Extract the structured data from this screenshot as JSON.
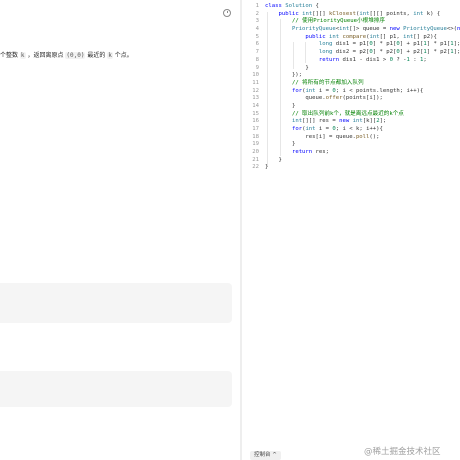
{
  "problem": {
    "desc_prefix": "个整数 ",
    "desc_k1": "k",
    "desc_mid": " ，返回离原点 ",
    "desc_origin": "(0,0)",
    "desc_mid2": " 最近的 ",
    "desc_k2": "k",
    "desc_suffix": " 个点。"
  },
  "editor": {
    "line_numbers": [
      "1",
      "2",
      "3",
      "4",
      "5",
      "6",
      "7",
      "8",
      "9",
      "10",
      "11",
      "12",
      "13",
      "14",
      "15",
      "16",
      "17",
      "18",
      "19",
      "20",
      "21",
      "22"
    ],
    "code": {
      "l1": [
        "class",
        " ",
        "Solution",
        " {"
      ],
      "l2": [
        "    ",
        "public",
        " ",
        "int",
        "[][] ",
        "kClosest",
        "(",
        "int",
        "[][] points, ",
        "int",
        " k) {"
      ],
      "l3": [
        "        ",
        "// 使用PriorityQueue小根堆排序"
      ],
      "l4": [
        "        ",
        "PriorityQueue",
        "<",
        "int",
        "[]> queue = ",
        "new",
        " ",
        "PriorityQueue",
        "<>(",
        "new",
        " Comp"
      ],
      "l5": [
        "            ",
        "public",
        " ",
        "int",
        " ",
        "compare",
        "(",
        "int",
        "[] p1, ",
        "int",
        "[] p2){"
      ],
      "l6": [
        "                ",
        "long",
        " dis1 = p1[",
        "0",
        "] * p1[",
        "0",
        "] + p1[",
        "1",
        "] * p1[",
        "1",
        "];"
      ],
      "l7": [
        "                ",
        "long",
        " dis2 = p2[",
        "0",
        "] * p2[",
        "0",
        "] + p2[",
        "1",
        "] * p2[",
        "1",
        "];"
      ],
      "l8": [
        "                ",
        "return",
        " dis1 - dis1 > ",
        "0",
        " ? -",
        "1",
        " : ",
        "1",
        ";"
      ],
      "l9": [
        "            }"
      ],
      "l10": [
        "        });"
      ],
      "l11": [
        "        ",
        "// 将所有的节点都加入队列"
      ],
      "l12": [
        "        ",
        "for",
        "(",
        "int",
        " i = ",
        "0",
        "; i < points.length; i++){"
      ],
      "l13": [
        "            queue.",
        "offer",
        "(points[i]);"
      ],
      "l14": [
        "        }"
      ],
      "l15": [
        "        ",
        "// 取出队列前k个，就是离远点最近的k个点"
      ],
      "l16": [
        "        ",
        "int",
        "[][] res = ",
        "new",
        " ",
        "int",
        "[k][",
        "2",
        "];"
      ],
      "l17": [
        "        ",
        "for",
        "(",
        "int",
        " i = ",
        "0",
        "; i < k; i++){"
      ],
      "l18": [
        "            res[i] = queue.",
        "poll",
        "();"
      ],
      "l19": [
        "        }"
      ],
      "l20": [
        "        ",
        "return",
        " res;"
      ],
      "l21": [
        "    }"
      ],
      "l22": [
        "}"
      ]
    }
  },
  "status": {
    "label": "控制台 ^"
  },
  "watermark": {
    "text": "@稀土掘金技术社区"
  },
  "icons": {
    "timer": "clock-icon"
  }
}
